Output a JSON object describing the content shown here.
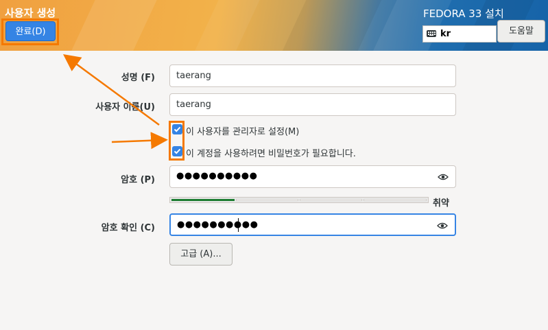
{
  "header": {
    "title": "사용자 생성",
    "done_label": "완료(D)",
    "install_title": "FEDORA 33 설치",
    "keyboard_layout": "kr",
    "keyboard_icon": "keyboard-icon",
    "help_label": "도움말"
  },
  "form": {
    "fullname_label": "성명 (F)",
    "fullname_value": "taerang",
    "username_label": "사용자 이름(U)",
    "username_value": "taerang",
    "admin_label": "이 사용자를 관리자로 설정(M)",
    "admin_checked": true,
    "require_password_label": "이 계정을 사용하려면 비밀번호가 필요합니다.",
    "require_password_checked": true,
    "password_label": "암호 (P)",
    "password_value": "●●●●●●●●●●",
    "password_strength_label": "취약",
    "password_strength_fraction": 0.25,
    "confirm_label": "암호 확인 (C)",
    "confirm_value": "●●●●●●●●●●",
    "reveal_icon": "eye-icon",
    "advanced_label": "고급 (A)..."
  },
  "colors": {
    "accent": "#3584e4",
    "highlight": "#f57900",
    "strength_fill": "#1c7c31"
  }
}
